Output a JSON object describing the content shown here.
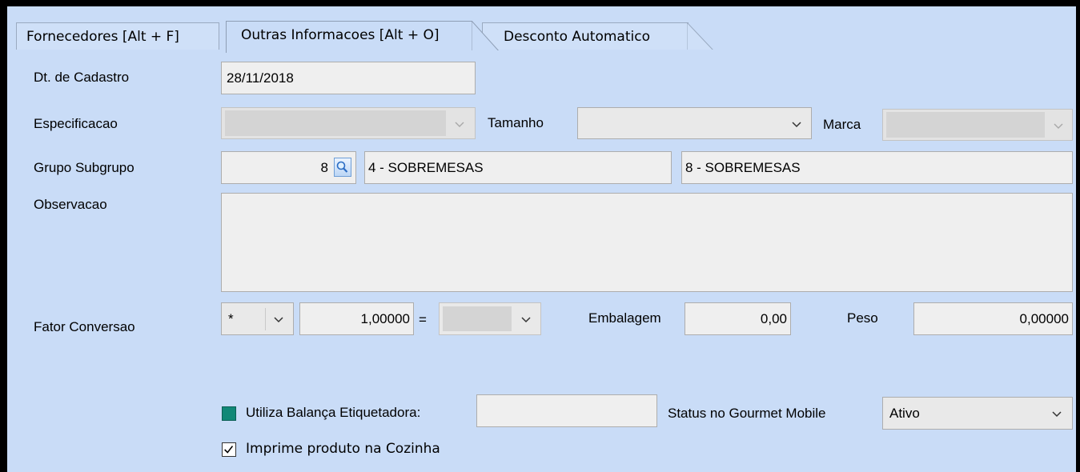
{
  "tabs": [
    {
      "label": "Fornecedores [Alt + F]",
      "active": false
    },
    {
      "label": "Outras Informacoes [Alt + O]",
      "active": true
    },
    {
      "label": "Desconto Automatico",
      "active": false
    }
  ],
  "form": {
    "dt_cadastro": {
      "label": "Dt. de Cadastro",
      "value": "28/11/2018"
    },
    "especificacao": {
      "label": "Especificacao",
      "value": ""
    },
    "tamanho": {
      "label": "Tamanho",
      "value": ""
    },
    "marca": {
      "label": "Marca",
      "value": ""
    },
    "grupo_subgrupo": {
      "label": "Grupo Subgrupo",
      "code": "8",
      "grupo": "4 - SOBREMESAS",
      "subgrupo": "8 - SOBREMESAS"
    },
    "observacao": {
      "label": "Observacao",
      "value": ""
    },
    "fator_conversao": {
      "label": "Fator Conversao",
      "operator": "*",
      "value": "1,00000",
      "equals": "=",
      "unit": ""
    },
    "embalagem": {
      "label": "Embalagem",
      "value": "0,00"
    },
    "peso": {
      "label": "Peso",
      "value": "0,00000"
    },
    "balanca": {
      "label": "Utiliza Balança Etiquetadora:",
      "value": ""
    },
    "gourmet": {
      "label": "Status no Gourmet Mobile",
      "value": "Ativo"
    },
    "cozinha": {
      "label": "Imprime produto na Cozinha",
      "checked": true
    }
  },
  "icons": {
    "dropdown": "chevron-down-icon",
    "lookup": "magnifier-icon",
    "balanca": "teal-square-icon",
    "check": "checkmark-icon"
  },
  "colors": {
    "panel": "#c9dcf7",
    "field": "#efefef",
    "accent": "#118877"
  }
}
